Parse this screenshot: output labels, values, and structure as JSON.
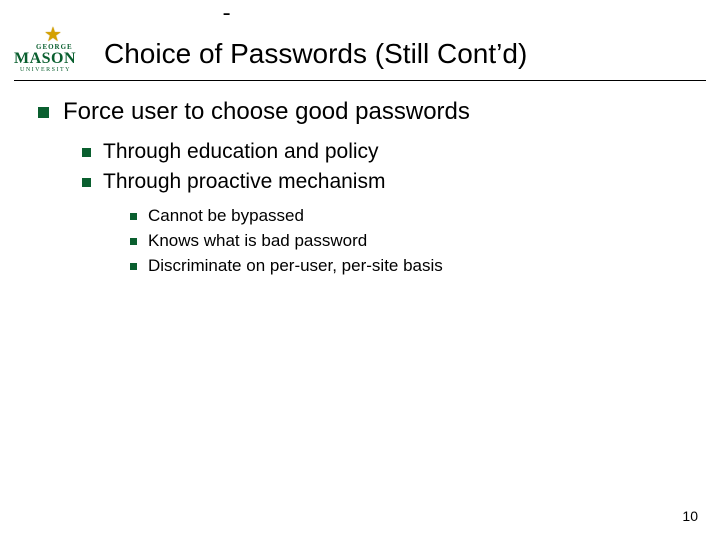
{
  "header": {
    "dash": "-",
    "logo": {
      "top": "GEORGE",
      "main": "MASON",
      "sub": "UNIVERSITY"
    },
    "title": "Choice of Passwords (Still Cont’d)"
  },
  "bullets": {
    "l1": "Force user to choose good passwords",
    "l2a": "Through education and policy",
    "l2b": "Through proactive mechanism",
    "l3a": "Cannot be bypassed",
    "l3b": "Knows what is bad password",
    "l3c": "Discriminate on per-user, per-site basis"
  },
  "page_number": "10"
}
